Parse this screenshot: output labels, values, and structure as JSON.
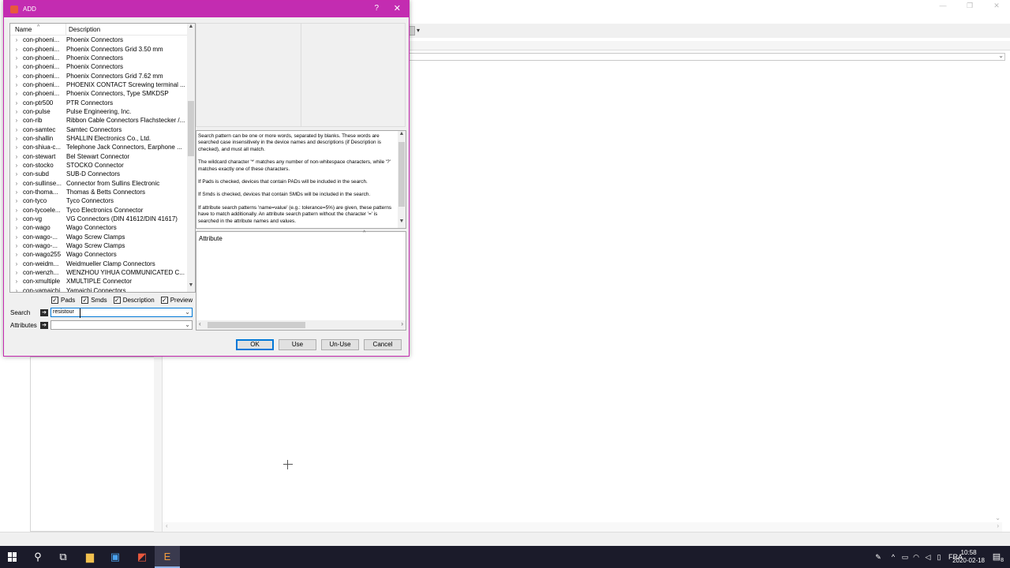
{
  "dialog": {
    "title": "ADD",
    "help_glyph": "?",
    "close_glyph": "✕",
    "accent_color": "#c32cb1",
    "columns": {
      "name": "Name",
      "description": "Description"
    },
    "libraries": [
      {
        "name": "con-phoeni...",
        "description": "Phoenix Connectors"
      },
      {
        "name": "con-phoeni...",
        "description": "Phoenix Connectors Grid 3.50 mm"
      },
      {
        "name": "con-phoeni...",
        "description": "Phoenix Connectors"
      },
      {
        "name": "con-phoeni...",
        "description": "Phoenix Connectors"
      },
      {
        "name": "con-phoeni...",
        "description": "Phoenix Connectors Grid 7.62 mm"
      },
      {
        "name": "con-phoeni...",
        "description": "PHOENIX CONTACT Screwing terminal ..."
      },
      {
        "name": "con-phoeni...",
        "description": "Phoenix Connectors, Type SMKDSP"
      },
      {
        "name": "con-ptr500",
        "description": "PTR Connectors"
      },
      {
        "name": "con-pulse",
        "description": "Pulse Engineering, Inc."
      },
      {
        "name": "con-rib",
        "description": "Ribbon Cable Connectors Flachstecker /..."
      },
      {
        "name": "con-samtec",
        "description": "Samtec Connectors"
      },
      {
        "name": "con-shallin",
        "description": "SHALLIN Electronics Co., Ltd."
      },
      {
        "name": "con-shiua-c...",
        "description": "Telephone Jack Connectors, Earphone ..."
      },
      {
        "name": "con-stewart",
        "description": "Bel Stewart Connector"
      },
      {
        "name": "con-stocko",
        "description": "STOCKO Connector"
      },
      {
        "name": "con-subd",
        "description": "SUB-D Connectors"
      },
      {
        "name": "con-sullinse...",
        "description": "Connector from Sullins Electronic"
      },
      {
        "name": "con-thoma...",
        "description": "Thomas & Betts Connectors"
      },
      {
        "name": "con-tyco",
        "description": "Tyco Connectors"
      },
      {
        "name": "con-tycoele...",
        "description": "Tyco Electronics Connector"
      },
      {
        "name": "con-vg",
        "description": "VG Connectors (DIN 41612/DIN 41617)"
      },
      {
        "name": "con-wago",
        "description": "Wago Connectors"
      },
      {
        "name": "con-wago-...",
        "description": "Wago Screw Clamps"
      },
      {
        "name": "con-wago-...",
        "description": "Wago Screw Clamps"
      },
      {
        "name": "con-wago255",
        "description": "Wago Connectors"
      },
      {
        "name": "con-weidm...",
        "description": "Weidmueller Clamp Connectors"
      },
      {
        "name": "con-wenzh...",
        "description": "WENZHOU YIHUA COMMUNICATED C..."
      },
      {
        "name": "con-xmultiple",
        "description": "XMULTIPLE Connector"
      },
      {
        "name": "con-yamaichi",
        "description": "Yamaichi Connectors"
      }
    ],
    "options": [
      {
        "label": "Pads",
        "checked": true
      },
      {
        "label": "Smds",
        "checked": true
      },
      {
        "label": "Description",
        "checked": true
      },
      {
        "label": "Preview",
        "checked": true
      }
    ],
    "search": {
      "label": "Search",
      "value": "resistour"
    },
    "attributes": {
      "label": "Attributes",
      "value": ""
    },
    "help_paragraphs": [
      "Search pattern can be one or more words, separated by blanks. These words are searched case insensitively in the device names and descriptions (if Description is checked), and must all match.",
      "The wildcard character '*' matches any number of non-whitespace characters, while '?' matches exactly one of these characters.",
      "If Pads is checked, devices that contain PADs will be included in the search.",
      "If Smds is checked, devices that contain SMDs will be included in the search.",
      "If attribute search patterns 'name=value' (e.g.: tolerance=5%) are given, these patterns have to match additionally. An attribute search pattern without the character '=' is searched in the attribute names and values."
    ],
    "attribute_header": "Attribute",
    "buttons": {
      "ok": "OK",
      "use": "Use",
      "unuse": "Un-Use",
      "cancel": "Cancel"
    }
  },
  "taskbar": {
    "language": "FRA",
    "time": "10:58",
    "date": "2020-02-18",
    "notification_count": "8"
  }
}
